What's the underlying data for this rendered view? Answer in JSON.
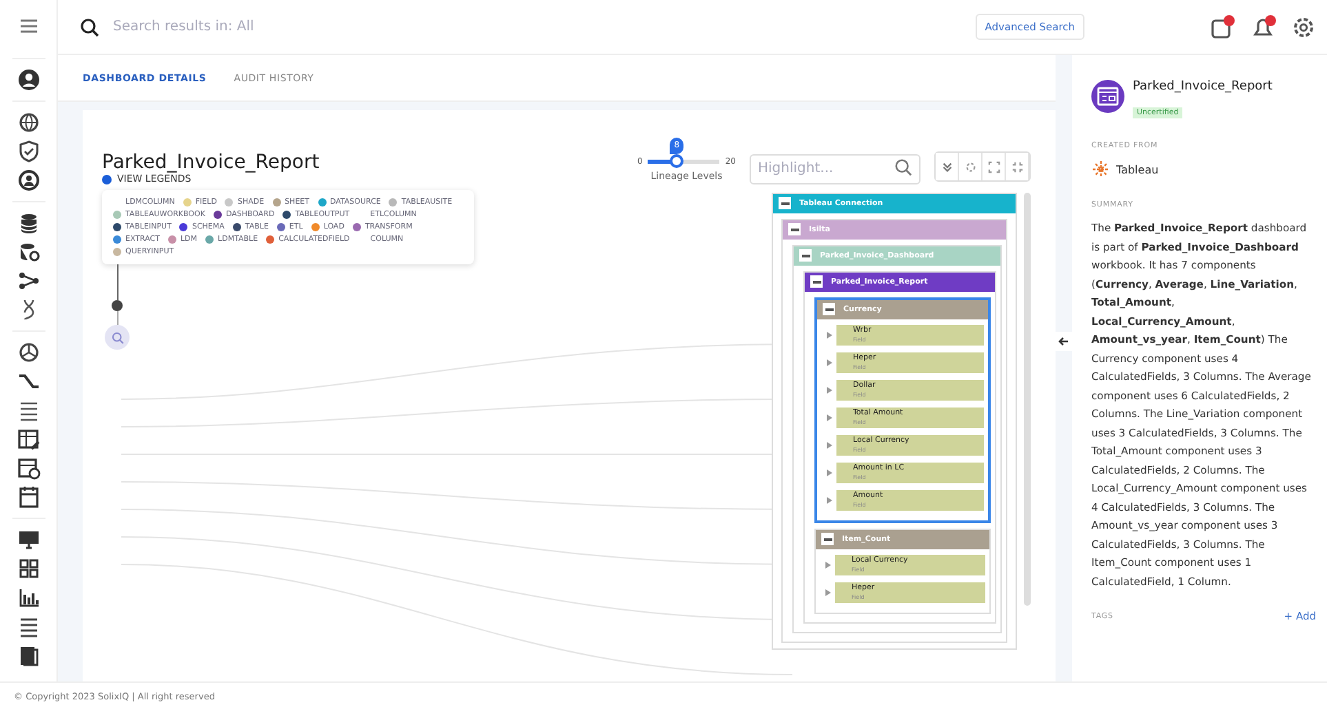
{
  "search": {
    "placeholder": "Search results in: All"
  },
  "advanced_search": "Advanced Search",
  "tabs": [
    {
      "label": "DASHBOARD DETAILS",
      "selected": true
    },
    {
      "label": "AUDIT HISTORY",
      "selected": false
    }
  ],
  "lineage": {
    "title": "Parked_Invoice_Report",
    "view_legends": "VIEW LEGENDS",
    "legend": [
      {
        "label": "LDMCOLUMN"
      },
      {
        "label": "FIELD",
        "color": "#e6d48c"
      },
      {
        "label": "SHADE",
        "color": "#c8c8c8"
      },
      {
        "label": "SHEET",
        "color": "#b5a58c"
      },
      {
        "label": "DATASOURCE",
        "color": "#1ea7c8"
      },
      {
        "label": "TABLEAUSITE",
        "color": "#b9b9b9"
      },
      {
        "label": "TABLEAUWORKBOOK",
        "color": "#a8c9b6"
      },
      {
        "label": "DASHBOARD",
        "color": "#6a3a9a"
      },
      {
        "label": "TABLEOUTPUT",
        "color": "#2e4a6b"
      },
      {
        "label": "ETLCOLUMN"
      },
      {
        "label": "TABLEINPUT",
        "color": "#2e4a6b"
      },
      {
        "label": "SCHEMA",
        "color": "#4a3ad8"
      },
      {
        "label": "TABLE",
        "color": "#3a4a6b"
      },
      {
        "label": "ETL",
        "color": "#6a6ab8"
      },
      {
        "label": "LOAD",
        "color": "#f08a2a"
      },
      {
        "label": "TRANSFORM",
        "color": "#9a6ab0"
      },
      {
        "label": "EXTRACT",
        "color": "#3a8ad8"
      },
      {
        "label": "LDM",
        "color": "#c890a8"
      },
      {
        "label": "LDMTABLE",
        "color": "#6aa8a8"
      },
      {
        "label": "CALCULATEDFIELD",
        "color": "#e0603a"
      },
      {
        "label": "COLUMN"
      },
      {
        "label": "QUERYINPUT",
        "color": "#c8b8a0"
      }
    ],
    "levels": {
      "min": "0",
      "max": "20",
      "value": "8",
      "level": 0.4,
      "caption": "Lineage Levels"
    },
    "highlight": {
      "placeholder": "Highlight..."
    },
    "tree": [
      {
        "kind": "group",
        "label": "Tableau Connection",
        "color": "#17b3cc",
        "highlighted": false,
        "children": [
          {
            "kind": "group",
            "label": "Isilta",
            "color": "#c9a8d0",
            "highlighted": false,
            "children": [
              {
                "kind": "group",
                "label": "Parked_Invoice_Dashboard",
                "color": "#a8d4c4",
                "highlighted": false,
                "children": [
                  {
                    "kind": "group",
                    "label": "Parked_Invoice_Report",
                    "color": "#6f3cc4",
                    "highlighted": false,
                    "children": [
                      {
                        "kind": "group",
                        "label": "Currency",
                        "color": "#aaa090",
                        "highlighted": true,
                        "children": [
                          {
                            "kind": "field",
                            "label": "Wrbr",
                            "sub": "Field"
                          },
                          {
                            "kind": "field",
                            "label": "Heper",
                            "sub": "Field"
                          },
                          {
                            "kind": "field",
                            "label": "Dollar",
                            "sub": "Field"
                          },
                          {
                            "kind": "field",
                            "label": "Total Amount",
                            "sub": "Field"
                          },
                          {
                            "kind": "field",
                            "label": "Local Currency",
                            "sub": "Field"
                          },
                          {
                            "kind": "field",
                            "label": "Amount in LC",
                            "sub": "Field"
                          },
                          {
                            "kind": "field",
                            "label": "Amount",
                            "sub": "Field"
                          }
                        ]
                      },
                      {
                        "kind": "group",
                        "label": "Item_Count",
                        "color": "#aaa090",
                        "highlighted": false,
                        "children": [
                          {
                            "kind": "field",
                            "label": "Local Currency",
                            "sub": "Field"
                          },
                          {
                            "kind": "field",
                            "label": "Heper",
                            "sub": "Field"
                          }
                        ]
                      }
                    ]
                  }
                ]
              }
            ]
          }
        ]
      }
    ]
  },
  "details": {
    "title": "Parked_Invoice_Report",
    "badge": "Uncertified",
    "created_from_heading": "CREATED FROM",
    "source": "Tableau",
    "summary_heading": "SUMMARY",
    "summary": "The **Parked_Invoice_Report** dashboard is part of **Parked_Invoice_Dashboard** workbook. It has 7 components (**Currency**, **Average**, **Line_Variation**, **Total_Amount**, **Local_Currency_Amount**, **Amount_vs_year**, **Item_Count**) The Currency component uses 4 CalculatedFields, 3 Columns. The Average component uses 6 CalculatedFields, 2 Columns. The Line_Variation component uses 3 CalculatedFields, 3 Columns. The Total_Amount component uses 3 CalculatedFields, 2 Columns. The Local_Currency_Amount component uses 4 CalculatedFields, 3 Columns. The Amount_vs_year component uses 3 CalculatedFields, 3 Columns. The Item_Count component uses 1 CalculatedField, 1 Column.",
    "tags_heading": "TAGS",
    "add_tag": "+ Add"
  },
  "footer": "© Copyright 2023 SolixIQ | All right reserved"
}
